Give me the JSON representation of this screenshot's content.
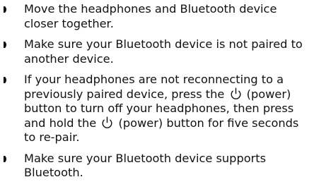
{
  "items": [
    {
      "text": "Move the headphones and Bluetooth device closer together."
    },
    {
      "text": "Make sure your Bluetooth device is not paired to another device."
    },
    {
      "part1": "If your headphones are not reconnecting to a previously paired device, press the ",
      "icon1": "power-icon",
      "part2": " (power) button to turn off your headphones, then press and hold the ",
      "icon2": "power-icon",
      "part3": " (power) button for five seconds to re-pair."
    },
    {
      "text": "Make sure your Bluetooth device supports Bluetooth."
    }
  ],
  "colors": {
    "text": "#111111",
    "bullet": "#111111"
  }
}
